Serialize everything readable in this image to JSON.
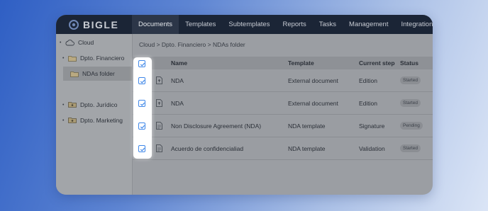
{
  "app": {
    "logo_text": "BIGLE"
  },
  "nav": {
    "tabs": [
      {
        "label": "Documents",
        "active": true
      },
      {
        "label": "Templates"
      },
      {
        "label": "Subtemplates"
      },
      {
        "label": "Reports"
      },
      {
        "label": "Tasks"
      },
      {
        "label": "Management"
      },
      {
        "label": "Integrations"
      }
    ]
  },
  "sidebar": {
    "items": [
      {
        "label": "Cloud",
        "icon": "cloud-icon"
      },
      {
        "label": "Dpto. Financiero",
        "icon": "folder-icon"
      },
      {
        "label": "NDAs folder",
        "icon": "folder-icon",
        "selected": true
      },
      {
        "label": "Dpto. Jurídico",
        "icon": "shared-folder-icon"
      },
      {
        "label": "Dpto. Marketing",
        "icon": "shared-folder-icon"
      }
    ]
  },
  "breadcrumb": "Cloud > Dpto. Financiero > NDAs folder",
  "table": {
    "columns": [
      "Name",
      "Template",
      "Current step",
      "Status"
    ],
    "rows": [
      {
        "name": "NDA",
        "template": "External document",
        "step": "Edition",
        "status": "Started",
        "checked": true,
        "icon": "upload-doc-icon"
      },
      {
        "name": "NDA",
        "template": "External document",
        "step": "Edition",
        "status": "Started",
        "checked": true,
        "icon": "upload-doc-icon"
      },
      {
        "name": "Non Disclosure Agreement (NDA)",
        "template": "NDA template",
        "step": "Signature",
        "status": "Pending",
        "checked": true,
        "icon": "document-icon"
      },
      {
        "name": "Acuerdo de confidencialiad",
        "template": "NDA template",
        "step": "Validation",
        "status": "Started",
        "checked": true,
        "icon": "document-icon"
      }
    ]
  },
  "colors": {
    "accent": "#3f87e8",
    "topbar": "#1b2536"
  }
}
